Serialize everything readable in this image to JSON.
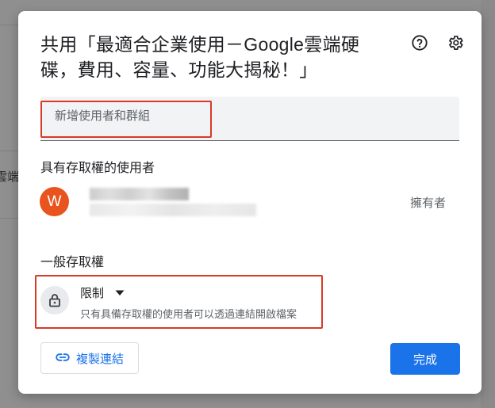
{
  "dialog": {
    "title": "共用「最適合企業使用－Google雲端硬碟，費用、容量、功能大揭秘！」",
    "help_icon": "help-circle-icon",
    "settings_icon": "gear-icon"
  },
  "add_people": {
    "placeholder": "新增使用者和群組"
  },
  "people_with_access": {
    "heading": "具有存取權的使用者",
    "people": [
      {
        "avatar_letter": "W",
        "avatar_color": "#e8531e",
        "role": "擁有者"
      }
    ]
  },
  "general_access": {
    "heading": "一般存取權",
    "selected": "限制",
    "description": "只有具備存取權的使用者可以透過連結開啟檔案",
    "icon": "lock-icon"
  },
  "footer": {
    "copy_link_label": "複製連結",
    "copy_link_icon": "link-icon",
    "done_label": "完成"
  },
  "backdrop": {
    "fragment_text": "e雲端"
  },
  "colors": {
    "accent": "#1a73e8",
    "highlight_box": "#d93a26",
    "avatar": "#e8531e"
  }
}
